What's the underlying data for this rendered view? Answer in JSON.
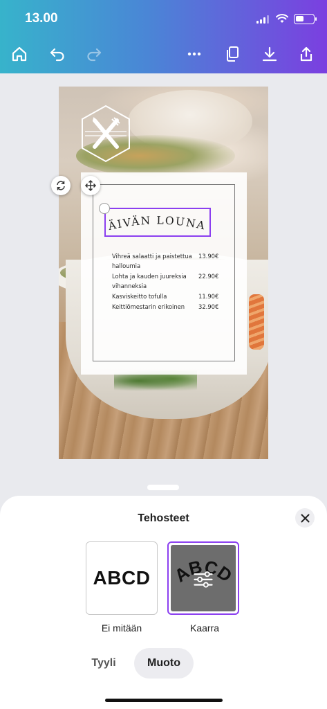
{
  "status_bar": {
    "time": "13.00"
  },
  "toolbar": {
    "icons": [
      "home-icon",
      "undo-icon",
      "redo-icon",
      "more-icon",
      "copy-icon",
      "download-icon",
      "share-icon"
    ]
  },
  "design": {
    "title": "PÄIVÄN LOUNAS",
    "menu": [
      {
        "name": "Vihreä salaatti ja paistettua halloumia",
        "price": "13.90€"
      },
      {
        "name": "Lohta ja kauden juureksia vihanneksia",
        "price": "22.90€"
      },
      {
        "name": "Kasviskeitto tofulla",
        "price": "11.90€"
      },
      {
        "name": "Keittiömestarin erikoinen",
        "price": "32.90€"
      }
    ]
  },
  "sheet": {
    "title": "Tehosteet",
    "options": [
      {
        "preview": "ABCD",
        "label": "Ei mitään"
      },
      {
        "preview": "ABCD",
        "label": "Kaarra"
      }
    ],
    "tabs": [
      "Tyyli",
      "Muoto"
    ],
    "active_tab": "Muoto"
  },
  "colors": {
    "accent": "#8b3ff0",
    "header_start": "#37b3cb",
    "header_end": "#7b3fe0"
  }
}
